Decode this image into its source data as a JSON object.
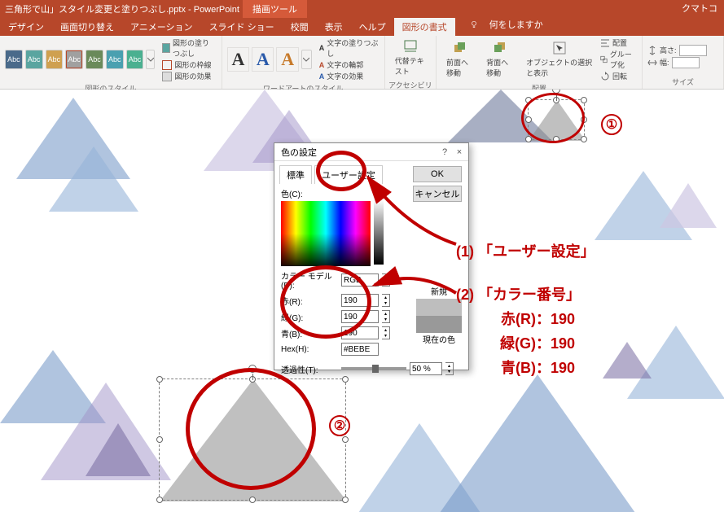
{
  "app": {
    "filename": "三角形で山」スタイル変更と塗りつぶし.pptx - PowerPoint",
    "tool_context": "描画ツール",
    "user": "クマトコ"
  },
  "tabs": {
    "items": [
      "デザイン",
      "画面切り替え",
      "アニメーション",
      "スライド ショー",
      "校閲",
      "表示",
      "ヘルプ",
      "図形の書式"
    ],
    "active": "図形の書式",
    "tell_me_placeholder": "何をしますか"
  },
  "ribbon": {
    "shape_styles": {
      "label": "図形のスタイル",
      "swatch_text": "Abc",
      "fill": "図形の塗りつぶし",
      "outline": "図形の枠線",
      "effects": "図形の効果"
    },
    "wordart": {
      "label": "ワードアートのスタイル",
      "text_fill": "文字の塗りつぶし",
      "text_outline": "文字の輪郭",
      "text_effects": "文字の効果"
    },
    "accessibility": {
      "label": "アクセシビリティ",
      "btn": "代替テキスト"
    },
    "arrange": {
      "label": "配置",
      "forward": "前面へ移動",
      "backward": "背面へ移動",
      "selection": "オブジェクトの選択と表示",
      "align": "配置",
      "group": "グループ化",
      "rotate": "回転"
    },
    "size": {
      "label": "サイズ",
      "height": "高さ:",
      "width": "幅:"
    }
  },
  "dialog": {
    "title": "色の設定",
    "tab_standard": "標準",
    "tab_custom": "ユーザー設定",
    "ok": "OK",
    "cancel": "キャンセル",
    "color_label": "色(C):",
    "model_label": "カラー モデル(D):",
    "model_value": "RGB",
    "r_label": "赤(R):",
    "g_label": "緑(G):",
    "b_label": "青(B):",
    "hex_label": "Hex(H):",
    "r_value": "190",
    "g_value": "190",
    "b_value": "190",
    "hex_value": "#BEBE",
    "transparency_label": "透過性(T):",
    "transparency_value": "50 %",
    "new_label": "新規",
    "current_label": "現在の色"
  },
  "annotations": {
    "num1": "①",
    "num2": "②",
    "line1": "(1) 「ユーザー設定」",
    "line2": "(2) 「カラー番号」",
    "r": "赤(R)：190",
    "g": "緑(G)：190",
    "b": "青(B)：190"
  },
  "colors": {
    "title": "#b7472a",
    "anno": "#c00000",
    "triangles": {
      "purple1": "rgba(118,106,160,0.55)",
      "purple2": "rgba(160,146,200,0.5)",
      "blue1": "rgba(111,147,196,0.55)",
      "blue2": "rgba(150,180,216,0.6)",
      "lav": "rgba(205,198,226,0.7)",
      "grey": "rgba(140,140,140,0.5)",
      "slate": "rgba(110,122,155,0.6)"
    }
  }
}
